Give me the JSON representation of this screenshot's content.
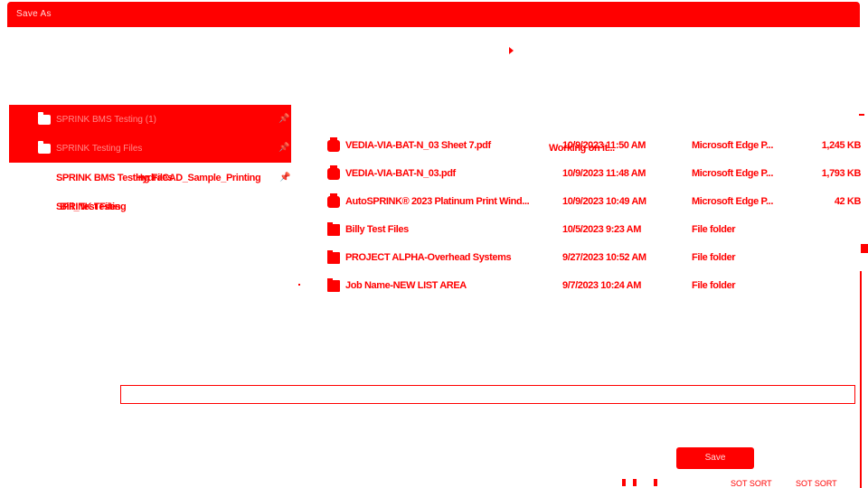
{
  "window": {
    "title": "Save As"
  },
  "quick_access": [
    {
      "label": "SPRINK BMS Testing (1)"
    },
    {
      "label": "SPRINK Testing Files"
    }
  ],
  "recent": {
    "item1": "SPRINK BMS Testing Files",
    "item1_overlay": "HydraCAD_Sample_Printing",
    "item2": "SPRINK Testing",
    "item2_overlay": "Bill_Test Files"
  },
  "working_overlay": "Working on it...",
  "files": [
    {
      "name": "VEDIA-VIA-BAT-N_03 Sheet 7.pdf",
      "date": "10/9/2023 11:50 AM",
      "type": "Microsoft Edge P...",
      "size": "1,245 KB",
      "icon": "pdf-icon"
    },
    {
      "name": "VEDIA-VIA-BAT-N_03.pdf",
      "date": "10/9/2023 11:48 AM",
      "type": "Microsoft Edge P...",
      "size": "1,793 KB",
      "icon": "pdf-icon"
    },
    {
      "name": "AutoSPRINK® 2023 Platinum Print Wind...",
      "date": "10/9/2023 10:49 AM",
      "type": "Microsoft Edge P...",
      "size": "42 KB",
      "icon": "pdf-icon"
    },
    {
      "name": "Billy Test Files",
      "date": "10/5/2023 9:23 AM",
      "type": "File folder",
      "size": "",
      "icon": "folder-icon"
    },
    {
      "name": "PROJECT ALPHA-Overhead Systems",
      "date": "9/27/2023 10:52 AM",
      "type": "File folder",
      "size": "",
      "icon": "folder-icon"
    },
    {
      "name": "Job Name-NEW LIST AREA",
      "date": "9/7/2023 10:24 AM",
      "type": "File folder",
      "size": "",
      "icon": "folder-icon"
    }
  ],
  "save_label": "Save",
  "bottom_strip": {
    "a": "SOT SORT",
    "b": "SOT SORT"
  },
  "colors": {
    "accent": "#ff0000",
    "background": "#ffffff"
  }
}
